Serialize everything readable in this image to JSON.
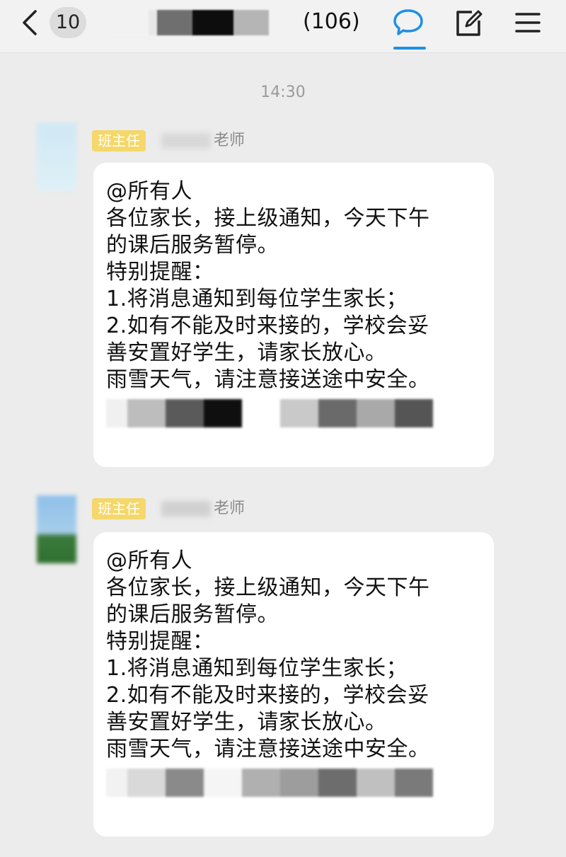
{
  "header": {
    "unread_count": "10",
    "member_count": "(106)",
    "icons": [
      "back-icon",
      "chat-icon",
      "edit-icon",
      "menu-icon"
    ],
    "active_tab_color": "#1f8fe6"
  },
  "timestamp": "14:30",
  "messages": [
    {
      "role": "班主任",
      "sender_suffix": "老师",
      "lines": [
        "@所有人",
        "各位家长，接上级通知，今天下午",
        "的课后服务暂停。",
        "特别提醒：",
        "1.将消息通知到每位学生家长；",
        "2.如有不能及时来接的，学校会妥",
        "善安置好学生，请家长放心。",
        "雨雪天气，请注意接送途中安全。"
      ]
    },
    {
      "role": "班主任",
      "sender_suffix": "老师",
      "lines": [
        "@所有人",
        "各位家长，接上级通知，今天下午",
        "的课后服务暂停。",
        "特别提醒：",
        "1.将消息通知到每位学生家长；",
        "2.如有不能及时来接的，学校会妥",
        "善安置好学生，请家长放心。",
        "雨雪天气，请注意接送途中安全。"
      ]
    }
  ],
  "colors": {
    "role_badge": "#f5d76a",
    "background": "#ececec",
    "bubble": "#ffffff"
  }
}
